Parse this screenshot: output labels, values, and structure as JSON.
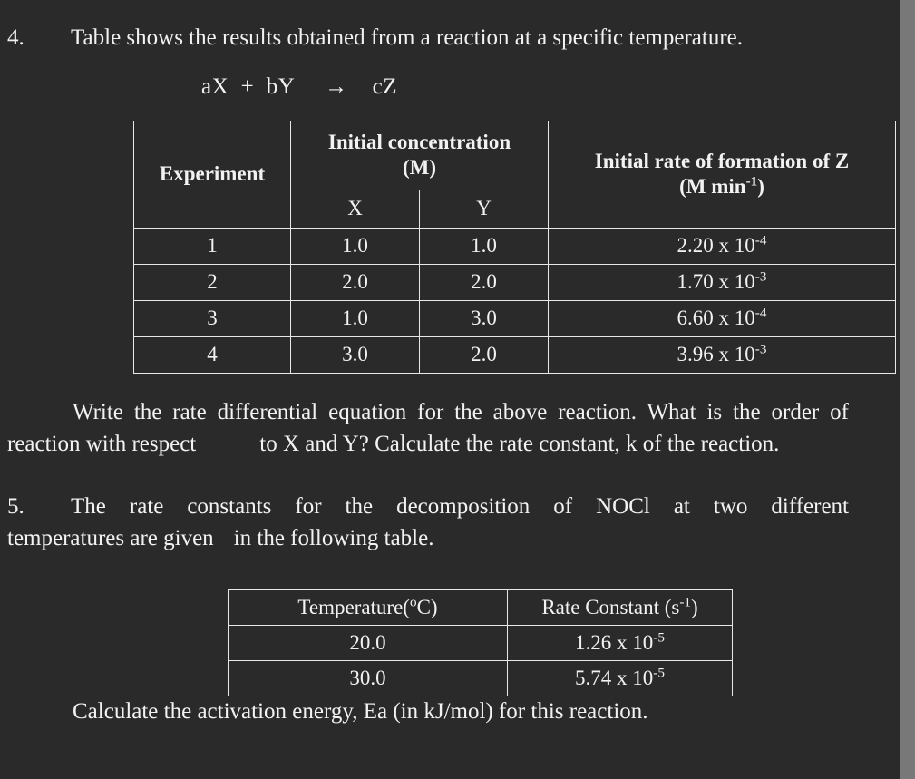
{
  "questions": {
    "q4": {
      "number": "4.",
      "stem": "Table shows the results obtained from a reaction at a specific temperature.",
      "equation": "aX  +  bY     →    cZ",
      "follow_up_part1": "Write the rate differential equation for the above reaction. What is the order of reaction with respect",
      "follow_up_part2": "to X and Y? Calculate the rate constant, k of the reaction."
    },
    "q5": {
      "number": "5.",
      "stem_line1": "The rate constants for the decomposition of NOCl at two different",
      "stem_line2a": "temperatures are given",
      "stem_line2b": "in the following table.",
      "closing": "Calculate the activation energy, Ea (in kJ/mol) for this reaction."
    }
  },
  "table1": {
    "header": {
      "experiment": "Experiment",
      "initial_concentration_line1": "Initial concentration",
      "initial_concentration_line2": "(M)",
      "sub_x": "X",
      "sub_y": "Y",
      "rate_line1": "Initial rate of formation of Z",
      "rate_line2_prefix": "(M min",
      "rate_line2_sup": "-1",
      "rate_line2_suffix": ")"
    },
    "rows": [
      {
        "experiment": "1",
        "x": "1.0",
        "y": "1.0",
        "rate_mantissa": "2.20 x 10",
        "rate_exp": "-4"
      },
      {
        "experiment": "2",
        "x": "2.0",
        "y": "2.0",
        "rate_mantissa": "1.70 x 10",
        "rate_exp": "-3"
      },
      {
        "experiment": "3",
        "x": "1.0",
        "y": "3.0",
        "rate_mantissa": "6.60 x 10",
        "rate_exp": "-4"
      },
      {
        "experiment": "4",
        "x": "3.0",
        "y": "2.0",
        "rate_mantissa": "3.96 x 10",
        "rate_exp": "-3"
      }
    ]
  },
  "table2": {
    "header": {
      "temperature_prefix": "Temperature(",
      "temperature_sup": "o",
      "temperature_suffix": "C)",
      "rate_constant_prefix": "Rate Constant (s",
      "rate_constant_sup": "-1",
      "rate_constant_suffix": ")"
    },
    "rows": [
      {
        "temperature": "20.0",
        "rate_mantissa": "1.26 x 10",
        "rate_exp": "-5"
      },
      {
        "temperature": "30.0",
        "rate_mantissa": "5.74 x 10",
        "rate_exp": "-5"
      }
    ]
  },
  "theme": {
    "background": "#2a2a2a",
    "text": "#f2f2f2",
    "rule": "#e8e8e8",
    "scrollbar": "#787878"
  }
}
